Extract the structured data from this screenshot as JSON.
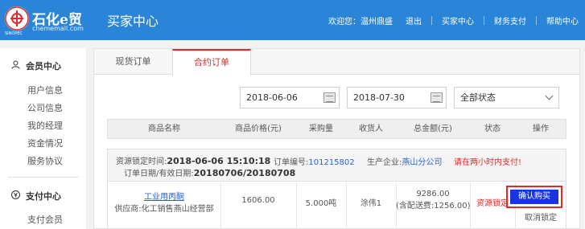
{
  "header": {
    "logo_name": "石化e贸",
    "logo_sub": "chememall.com",
    "logo_small": "SINOPEC",
    "title": "买家中心",
    "nav": {
      "welcome": "欢迎您：温州鼎盛",
      "logout": "退出",
      "buyer_center": "买家中心",
      "finance": "财务支付",
      "help": "帮助中心"
    }
  },
  "sidebar": {
    "member_center": "会员中心",
    "member_items": [
      "用户信息",
      "公司信息",
      "我的经理",
      "资金情况",
      "服务协议"
    ],
    "pay_center": "支付中心",
    "pay_items": [
      "支付会员"
    ]
  },
  "tabs": [
    "现货订单",
    "合约订单"
  ],
  "filters": {
    "start_date": "2018-06-06",
    "end_date": "2018-07-30",
    "status": "全部状态"
  },
  "table": {
    "headers": [
      "商品名称",
      "商品价格(元)",
      "采购量",
      "收货人",
      "总金额(元)",
      "状态",
      "操作"
    ]
  },
  "order": {
    "lock_time_label": "资源锁定时间:",
    "lock_time": "2018-06-06 15:10:18",
    "order_no_label": "订单编号:",
    "order_no": "101215802",
    "producer_label": "生产企业:",
    "producer": "燕山分公司",
    "warning": "请在两小时内支付!",
    "dates_label": "订单日期/有效日期:",
    "dates": "20180706/20180708",
    "product": "工业用丙酮",
    "supplier": "供应商:化工销售燕山经营部",
    "price": "1606.00",
    "quantity": "5.000吨",
    "receiver": "涂伟1",
    "total": "9286.00",
    "delivery_fee": "(含配送费:1256.00)",
    "status": "资源锁定",
    "confirm_button": "确认购买",
    "cancel": "取消锁定"
  }
}
